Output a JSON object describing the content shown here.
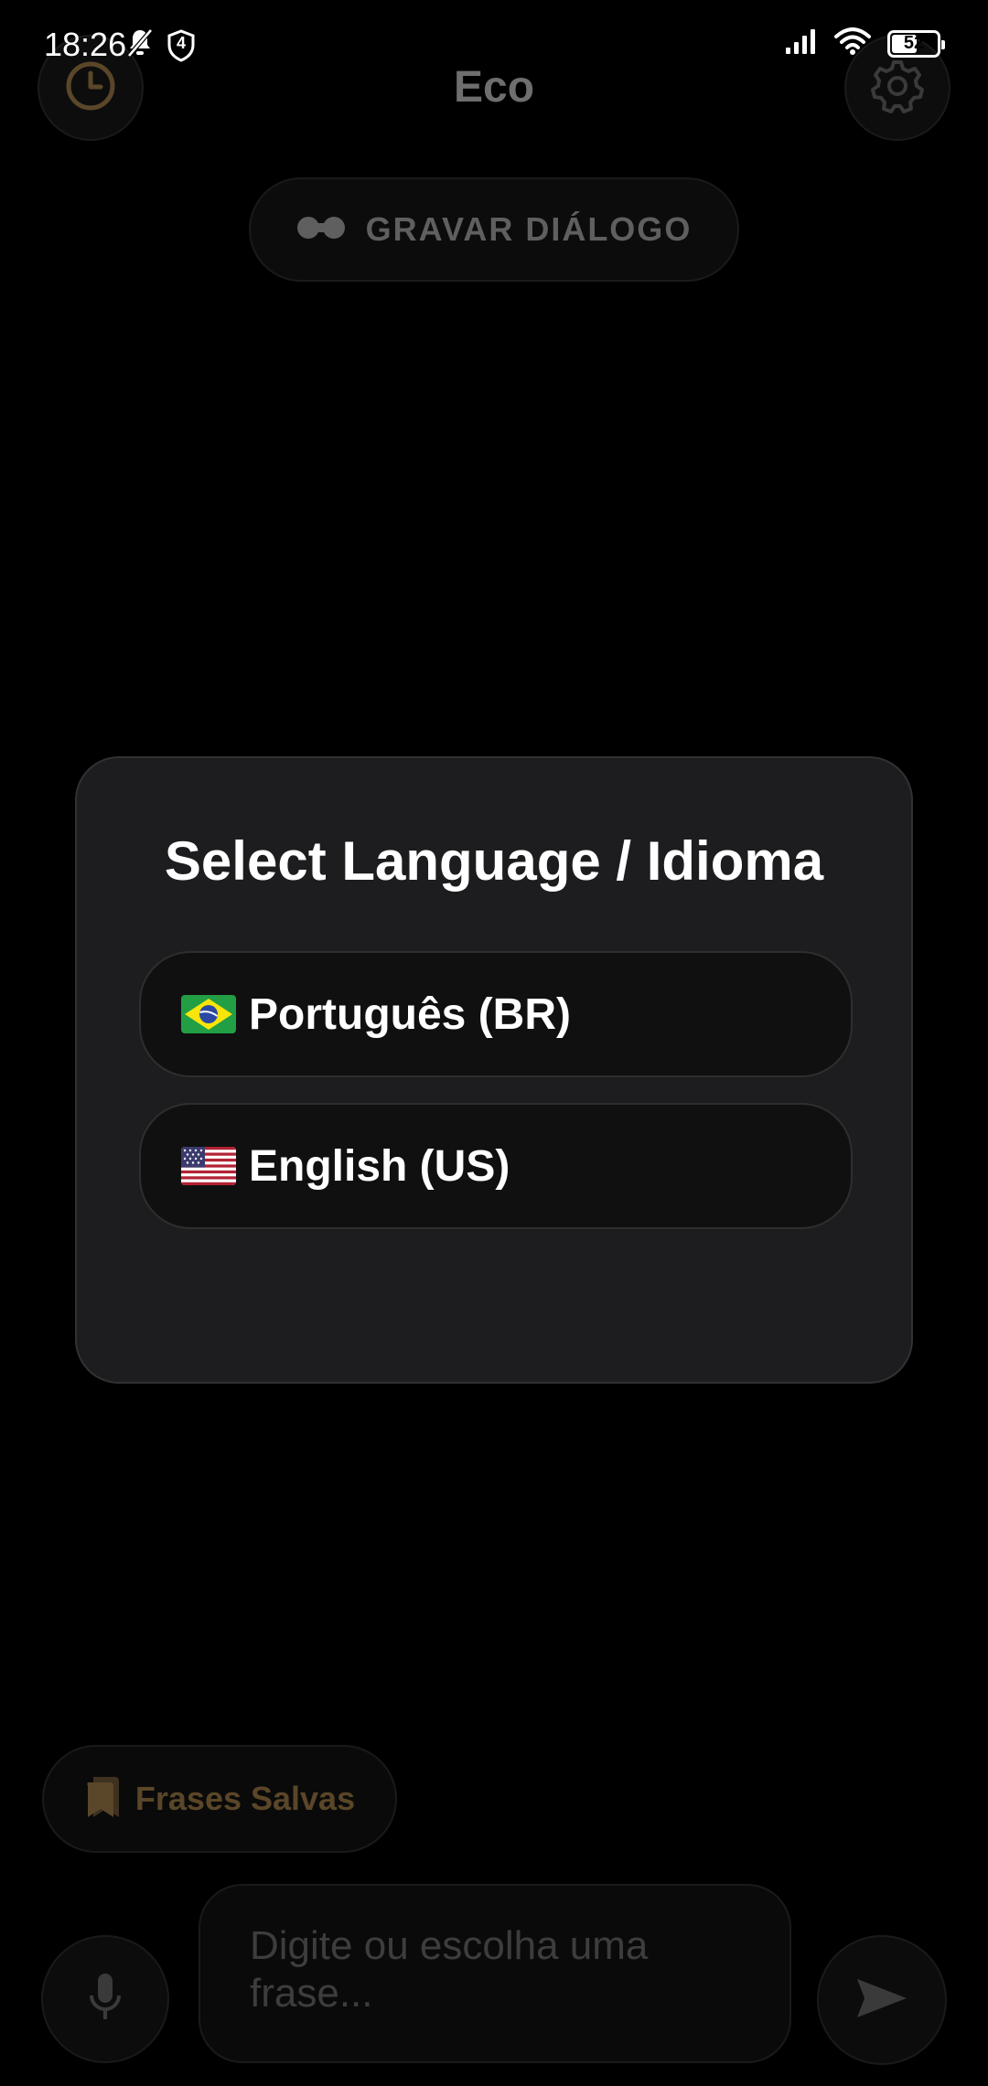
{
  "status_bar": {
    "time": "18:26",
    "badge_number": "4",
    "battery": "52",
    "battery_fraction": 0.52
  },
  "app": {
    "title": "Eco",
    "record_label": "GRAVAR DIÁLOGO",
    "saved_phrases_label": "Frases Salvas",
    "input": {
      "placeholder": "Digite ou escolha uma frase..."
    },
    "accent_color": "#8a6a3a"
  },
  "modal": {
    "title": "Select Language / Idioma",
    "options": [
      {
        "label": "Português (BR)",
        "flag": "brazil-flag-icon"
      },
      {
        "label": "English (US)",
        "flag": "us-flag-icon"
      }
    ]
  }
}
